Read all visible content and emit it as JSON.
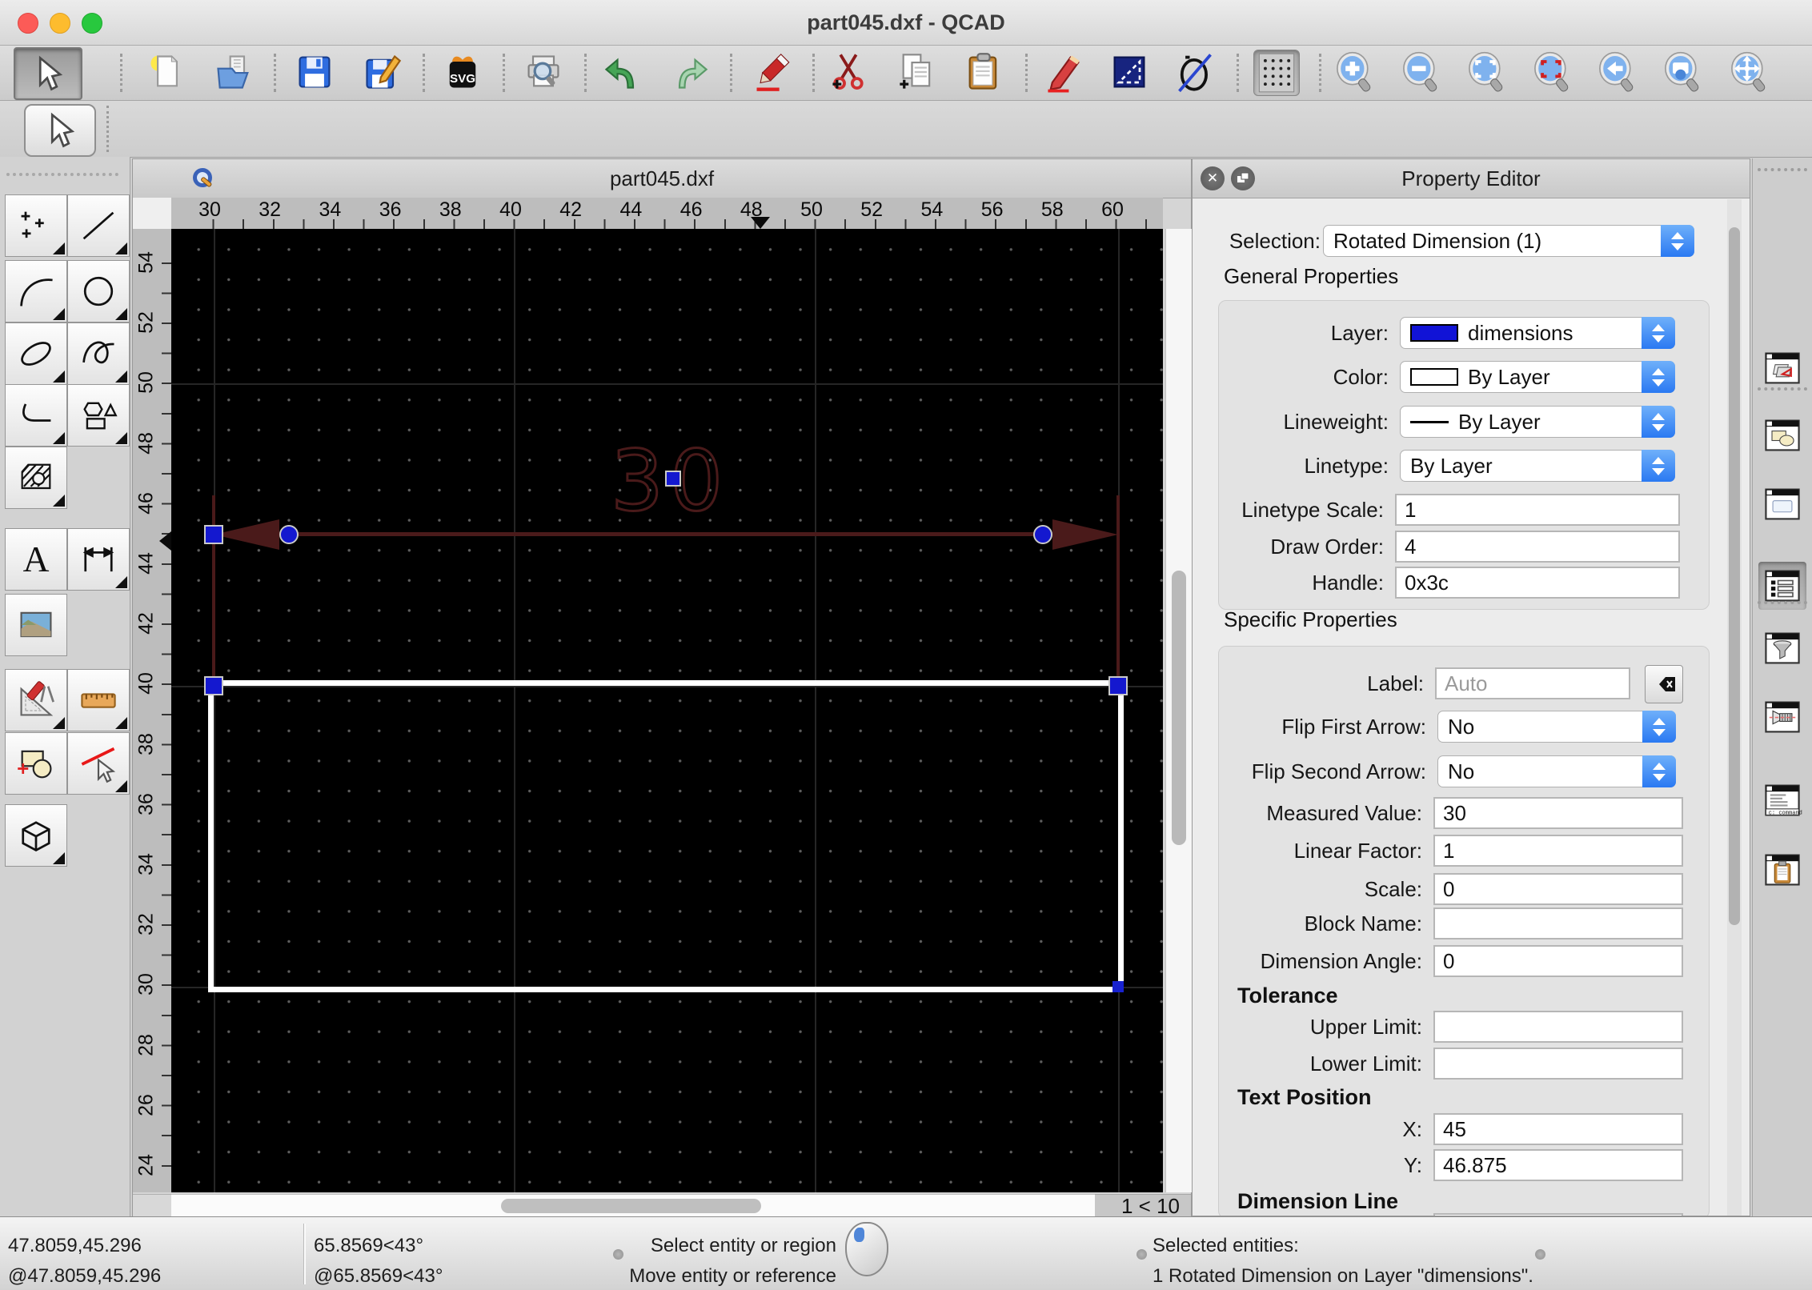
{
  "window": {
    "title": "part045.dxf - QCAD",
    "traffic_lights": [
      "close",
      "minimize",
      "zoom"
    ]
  },
  "toolbar": {
    "svg_label": "SVG",
    "buttons": [
      {
        "name": "selection-pointer-button",
        "icon": "cursor",
        "pressed": true
      },
      {
        "name": "new-drawing-button",
        "icon": "new"
      },
      {
        "name": "open-drawing-button",
        "icon": "open"
      },
      {
        "name": "save-button",
        "icon": "save"
      },
      {
        "name": "save-as-button",
        "icon": "saveas"
      },
      {
        "name": "svg-export-button",
        "icon": "svg"
      },
      {
        "name": "print-preview-button",
        "icon": "print"
      },
      {
        "name": "undo-button",
        "icon": "undo"
      },
      {
        "name": "redo-button",
        "icon": "redo"
      },
      {
        "name": "delete-button",
        "icon": "eraser"
      },
      {
        "name": "cut-button",
        "icon": "cut"
      },
      {
        "name": "copy-button",
        "icon": "copy"
      },
      {
        "name": "paste-button",
        "icon": "paste"
      },
      {
        "name": "edit-pencil-button",
        "icon": "pencil"
      },
      {
        "name": "selection-box-button",
        "icon": "selrect"
      },
      {
        "name": "no-fill-button",
        "icon": "nofill"
      },
      {
        "name": "grid-toggle-button",
        "icon": "grid",
        "pressed": true
      },
      {
        "name": "zoom-in-button",
        "icon": "zin"
      },
      {
        "name": "zoom-out-button",
        "icon": "zout"
      },
      {
        "name": "auto-zoom-button",
        "icon": "zauto"
      },
      {
        "name": "zoom-selection-button",
        "icon": "zsel"
      },
      {
        "name": "previous-view-button",
        "icon": "zprev"
      },
      {
        "name": "zoom-window-button",
        "icon": "zwin"
      },
      {
        "name": "pan-button",
        "icon": "pan"
      }
    ]
  },
  "palette": {
    "text_glyph": "A",
    "items": [
      {
        "name": "point-tools",
        "icon": "points",
        "flyout": true
      },
      {
        "name": "line-tools",
        "icon": "line",
        "flyout": true
      },
      {
        "name": "arc-tools",
        "icon": "arc",
        "flyout": true
      },
      {
        "name": "circle-tools",
        "icon": "circle",
        "flyout": true
      },
      {
        "name": "ellipse-tools",
        "icon": "ellipse",
        "flyout": true
      },
      {
        "name": "spline-tools",
        "icon": "spline",
        "flyout": true
      },
      {
        "name": "polyline-tools",
        "icon": "polyline",
        "flyout": true
      },
      {
        "name": "shape-tools",
        "icon": "shapes",
        "flyout": true
      },
      {
        "name": "hatch-tools",
        "icon": "hatch",
        "flyout": true
      },
      {
        "name": "text-tool",
        "icon": "text",
        "flyout": false
      },
      {
        "name": "dimension-tools",
        "icon": "dim",
        "flyout": true
      },
      {
        "name": "image-tool",
        "icon": "image",
        "flyout": false
      },
      {
        "name": "modify-tools",
        "icon": "modify",
        "flyout": true
      },
      {
        "name": "measure-tools",
        "icon": "measure",
        "flyout": true
      },
      {
        "name": "block-tools",
        "icon": "block",
        "flyout": false
      },
      {
        "name": "attribute-tools",
        "icon": "redline",
        "flyout": true
      },
      {
        "name": "solid-tools",
        "icon": "cube",
        "flyout": true
      }
    ]
  },
  "drawing": {
    "doc_title": "part045.dxf",
    "h_ruler": [
      30,
      32,
      34,
      36,
      38,
      40,
      42,
      44,
      46,
      48,
      50,
      52,
      54,
      56,
      58,
      60
    ],
    "v_ruler": [
      54,
      52,
      50,
      48,
      46,
      44,
      42,
      40,
      38,
      36,
      34,
      32,
      30,
      28,
      26,
      24
    ],
    "grid_indicator": "1 < 10",
    "dimension_text": "30"
  },
  "property_editor": {
    "title": "Property Editor",
    "selection_label": "Selection:",
    "selection_value": "Rotated Dimension (1)",
    "general_section": "General Properties",
    "specific_section": "Specific Properties",
    "general_rows": [
      {
        "label": "Layer:",
        "type": "popup",
        "value": "dimensions",
        "swatch": "layer",
        "menu_button": true
      },
      {
        "label": "Color:",
        "type": "popup",
        "value": "By Layer",
        "swatch": "color"
      },
      {
        "label": "Lineweight:",
        "type": "popup",
        "value": "By Layer",
        "swatch": "line"
      },
      {
        "label": "Linetype:",
        "type": "popup",
        "value": "By Layer"
      },
      {
        "label": "Linetype Scale:",
        "type": "input",
        "value": "1"
      },
      {
        "label": "Draw Order:",
        "type": "input",
        "value": "4"
      },
      {
        "label": "Handle:",
        "type": "input",
        "value": "0x3c"
      }
    ],
    "specific_rows": [
      {
        "label": "Label:",
        "type": "input",
        "value": "",
        "placeholder": "Auto",
        "clear_button": true
      },
      {
        "label": "Flip First Arrow:",
        "type": "popup",
        "value": "No"
      },
      {
        "label": "Flip Second Arrow:",
        "type": "popup",
        "value": "No"
      },
      {
        "label": "Measured Value:",
        "type": "input",
        "value": "30"
      },
      {
        "label": "Linear Factor:",
        "type": "input",
        "value": "1"
      },
      {
        "label": "Scale:",
        "type": "input",
        "value": "0"
      },
      {
        "label": "Block Name:",
        "type": "input",
        "value": ""
      },
      {
        "label": "Dimension Angle:",
        "type": "input",
        "value": "0"
      },
      {
        "label": "Tolerance",
        "type": "heading"
      },
      {
        "label": "Upper Limit:",
        "type": "input",
        "value": ""
      },
      {
        "label": "Lower Limit:",
        "type": "input",
        "value": ""
      },
      {
        "label": "Text Position",
        "type": "heading"
      },
      {
        "label": "X:",
        "type": "input",
        "value": "45"
      },
      {
        "label": "Y:",
        "type": "input",
        "value": "46.875"
      },
      {
        "label": "Dimension Line",
        "type": "heading"
      },
      {
        "label": "",
        "type": "input",
        "value": ""
      }
    ]
  },
  "dock": {
    "command_label": "c:   command",
    "items": [
      {
        "name": "layer-list-panel-button",
        "icon": "layers"
      },
      {
        "name": "block-list-panel-button",
        "icon": "blocks"
      },
      {
        "name": "view-list-panel-button",
        "icon": "views"
      },
      {
        "name": "property-editor-panel-button",
        "icon": "props",
        "selected": true
      },
      {
        "name": "selection-filter-panel-button",
        "icon": "filter"
      },
      {
        "name": "library-browser-panel-button",
        "icon": "screw"
      },
      {
        "name": "command-line-panel-button",
        "icon": "cmd"
      },
      {
        "name": "clipboard-panel-button",
        "icon": "clip"
      }
    ]
  },
  "status": {
    "abs_coord": "47.8059,45.296",
    "rel_coord": "@47.8059,45.296",
    "abs_polar": "65.8569<43°",
    "rel_polar": "@65.8569<43°",
    "left_hint": "Select entity or region",
    "right_hint": "Move entity or reference",
    "selection_line1": "Selected entities:",
    "selection_line2": "1 Rotated Dimension on Layer \"dimensions\"."
  }
}
